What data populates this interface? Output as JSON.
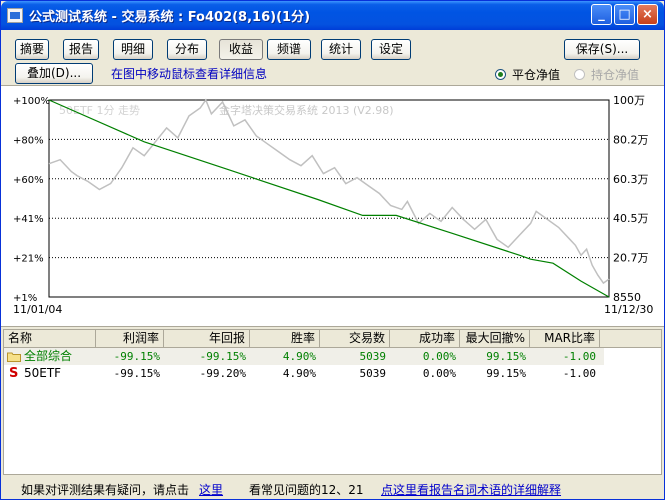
{
  "window": {
    "title": "公式测试系统 - 交易系统 : Fo402(8,16)(1分)",
    "controls": [
      "_",
      "□",
      "×"
    ]
  },
  "toolbar": {
    "tabs": [
      "摘要",
      "报告",
      "明细",
      "分布",
      "收益",
      "频谱",
      "统计",
      "设定"
    ],
    "active_tab": "收益",
    "save_label": "保存(S)...",
    "overlay_label": "叠加(D)...",
    "hint": "在图中移动鼠标查看详细信息",
    "radio_close": "平仓净值",
    "radio_hold": "持仓净值",
    "radio_selected": "平仓净值"
  },
  "chart_data": {
    "type": "line",
    "overlay_text_1": "50ETF 1分 走势",
    "overlay_text_2": "金字塔决策交易系统 2013 (V2.98)",
    "left_ticks": [
      "+100%",
      "+80%",
      "+60%",
      "+41%",
      "+21%",
      "+1%"
    ],
    "right_ticks": [
      "100万",
      "80.2万",
      "60.3万",
      "40.5万",
      "20.7万",
      "8550"
    ],
    "x_start": "11/01/04",
    "x_end": "11/12/30",
    "grid": true,
    "series": [
      {
        "name": "equity",
        "color": "#008000",
        "values": [
          [
            0,
            100
          ],
          [
            0.17,
            79
          ],
          [
            0.32,
            65
          ],
          [
            0.48,
            50
          ],
          [
            0.56,
            42
          ],
          [
            0.62,
            42
          ],
          [
            0.72,
            33
          ],
          [
            0.84,
            22
          ],
          [
            0.86,
            20
          ],
          [
            0.9,
            18
          ],
          [
            0.95,
            9
          ],
          [
            1.0,
            1
          ]
        ]
      },
      {
        "name": "price",
        "color": "#c0c0c0",
        "values": [
          [
            0,
            68
          ],
          [
            0.02,
            70
          ],
          [
            0.04,
            64
          ],
          [
            0.05,
            62
          ],
          [
            0.07,
            59
          ],
          [
            0.09,
            55
          ],
          [
            0.11,
            58
          ],
          [
            0.13,
            66
          ],
          [
            0.15,
            76
          ],
          [
            0.17,
            72
          ],
          [
            0.19,
            79
          ],
          [
            0.21,
            86
          ],
          [
            0.23,
            81
          ],
          [
            0.25,
            92
          ],
          [
            0.27,
            96
          ],
          [
            0.28,
            100
          ],
          [
            0.29,
            93
          ],
          [
            0.31,
            99
          ],
          [
            0.33,
            87
          ],
          [
            0.35,
            90
          ],
          [
            0.37,
            82
          ],
          [
            0.39,
            78
          ],
          [
            0.41,
            74
          ],
          [
            0.43,
            70
          ],
          [
            0.45,
            67
          ],
          [
            0.47,
            72
          ],
          [
            0.49,
            63
          ],
          [
            0.51,
            66
          ],
          [
            0.53,
            58
          ],
          [
            0.55,
            61
          ],
          [
            0.57,
            57
          ],
          [
            0.59,
            53
          ],
          [
            0.61,
            47
          ],
          [
            0.63,
            45
          ],
          [
            0.64,
            49
          ],
          [
            0.66,
            38
          ],
          [
            0.68,
            43
          ],
          [
            0.7,
            39
          ],
          [
            0.72,
            46
          ],
          [
            0.74,
            40
          ],
          [
            0.76,
            35
          ],
          [
            0.78,
            40
          ],
          [
            0.8,
            30
          ],
          [
            0.82,
            26
          ],
          [
            0.84,
            32
          ],
          [
            0.86,
            38
          ],
          [
            0.87,
            44
          ],
          [
            0.89,
            40
          ],
          [
            0.91,
            36
          ],
          [
            0.93,
            30
          ],
          [
            0.94,
            27
          ],
          [
            0.95,
            22
          ],
          [
            0.96,
            25
          ],
          [
            0.97,
            17
          ],
          [
            0.98,
            12
          ],
          [
            0.99,
            8
          ],
          [
            1.0,
            10
          ]
        ]
      }
    ]
  },
  "table": {
    "headers": [
      "名称",
      "利润率",
      "年回报",
      "胜率",
      "交易数",
      "成功率",
      "最大回撤%",
      "MAR比率"
    ],
    "rows": [
      {
        "icon": "folder-icon",
        "name": "全部综合",
        "profit": "-99.15%",
        "annual": "-99.15%",
        "win": "4.90%",
        "trades": "5039",
        "success": "0.00%",
        "drawdown": "99.15%",
        "mar": "-1.00"
      },
      {
        "icon": "s-icon",
        "icon_glyph": "S",
        "name": "50ETF",
        "profit": "-99.15%",
        "annual": "-99.20%",
        "win": "4.90%",
        "trades": "5039",
        "success": "0.00%",
        "drawdown": "99.15%",
        "mar": "-1.00"
      }
    ]
  },
  "status": {
    "text1": "如果对评测结果有疑问，请点击",
    "link1": "这里",
    "text2": "看常见问题的12、21",
    "link2": "点这里看报告名词术语的详细解释"
  }
}
